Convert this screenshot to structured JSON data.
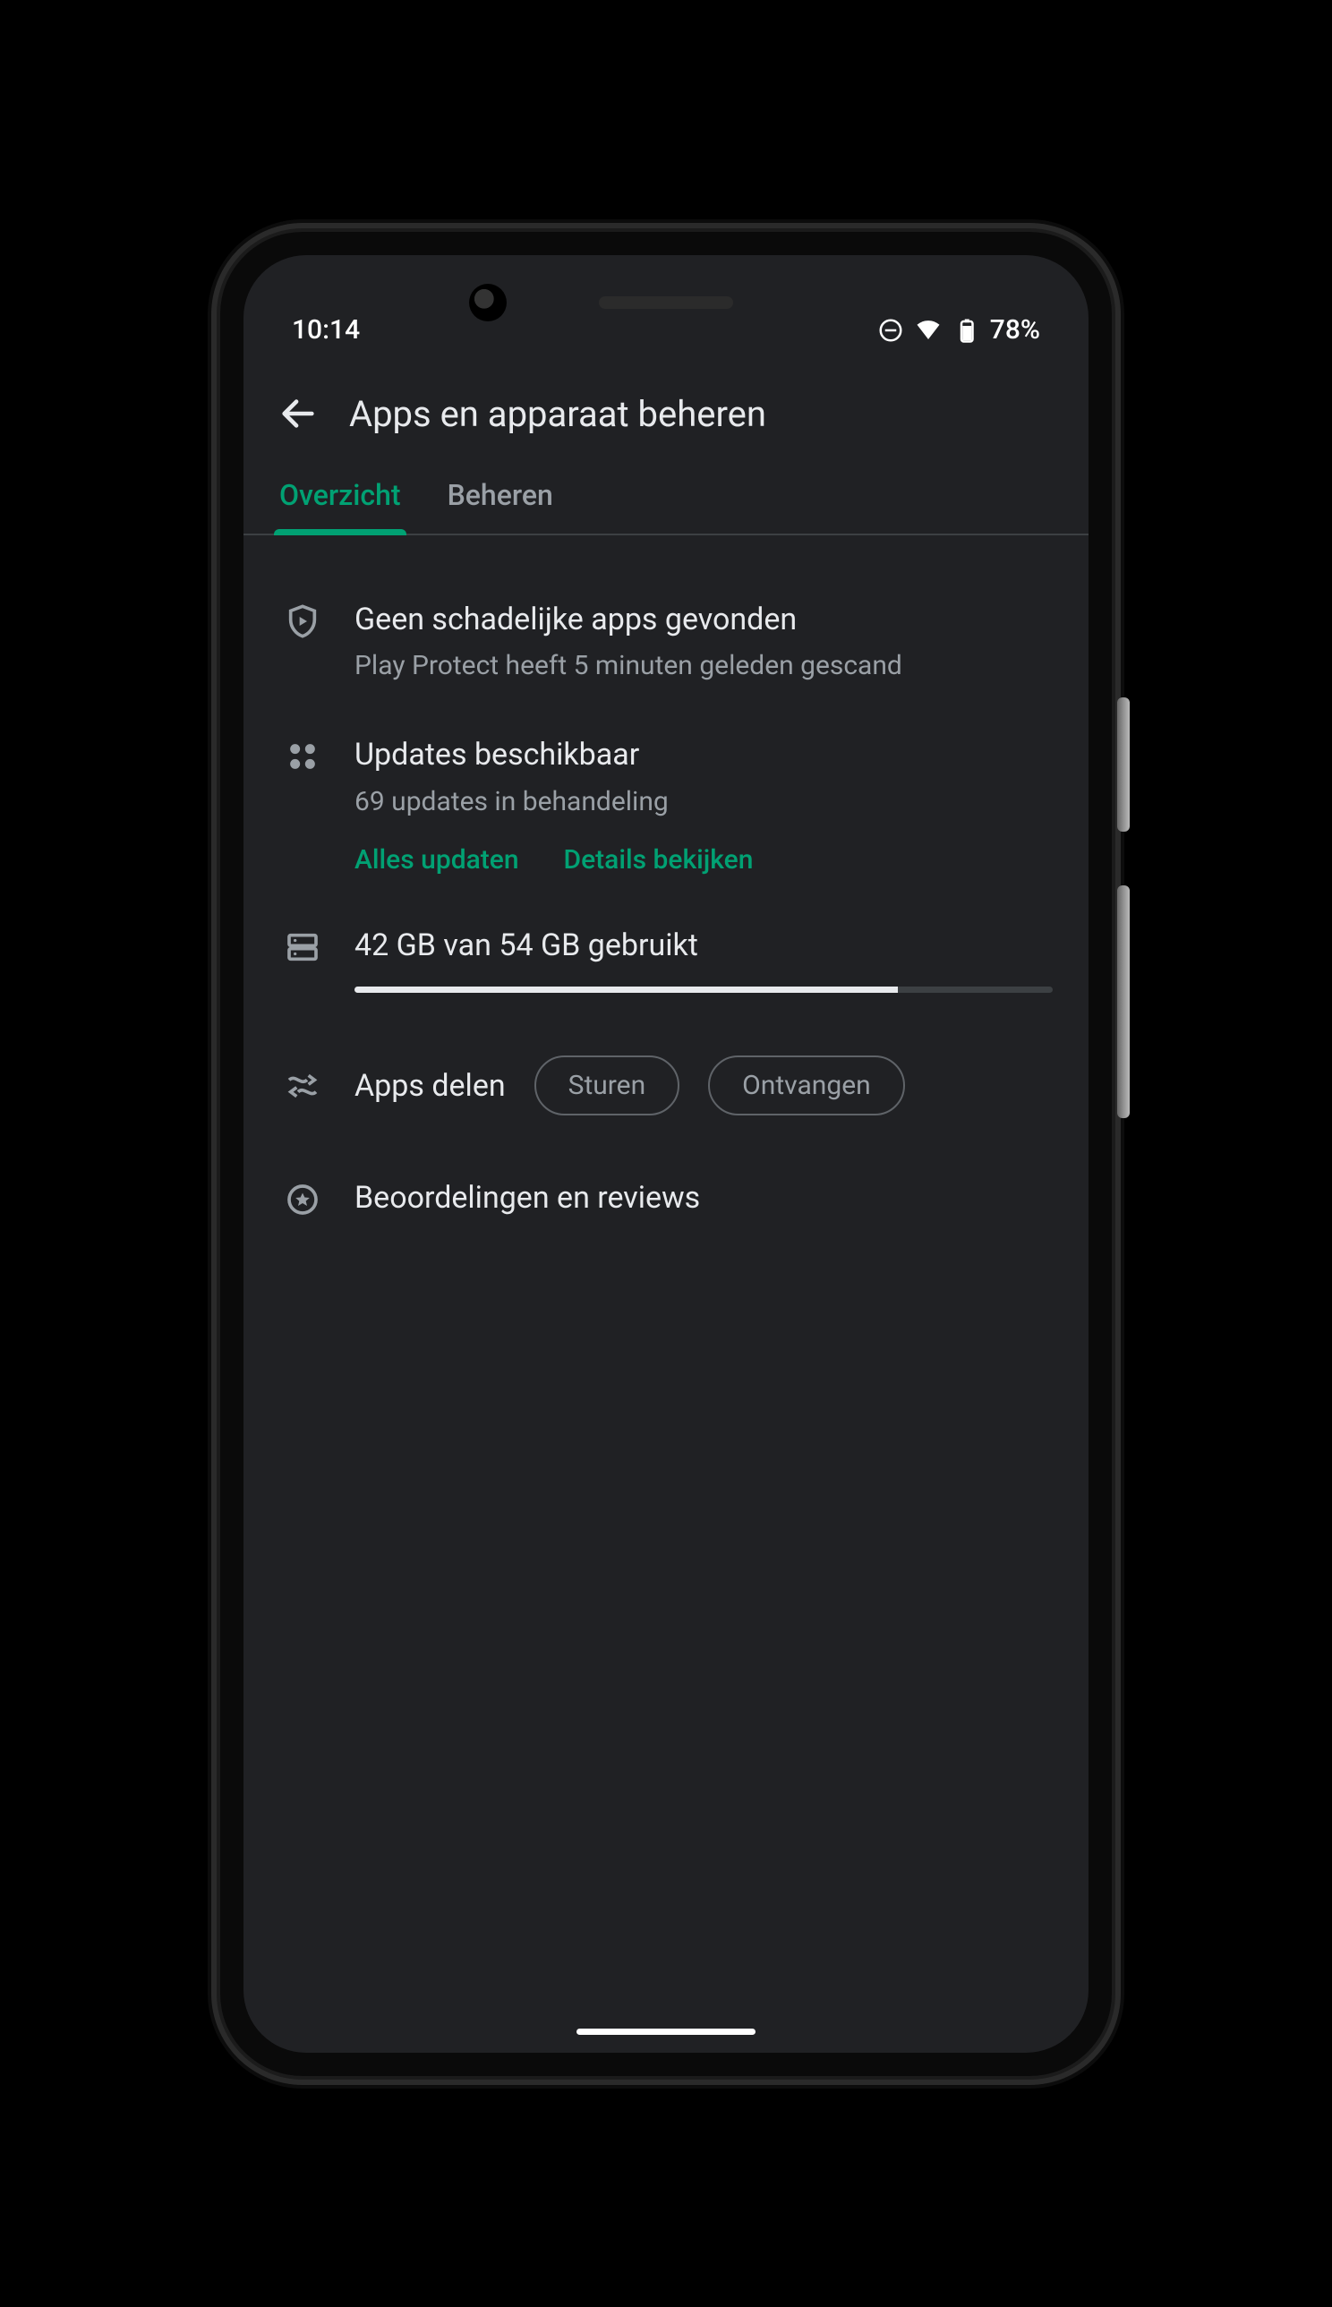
{
  "status": {
    "time": "10:14",
    "battery_text": "78%"
  },
  "header": {
    "title": "Apps en apparaat beheren"
  },
  "tabs": {
    "active": "Overzicht",
    "inactive": "Beheren"
  },
  "protect": {
    "title": "Geen schadelijke apps gevonden",
    "subtitle": "Play Protect heeft 5 minuten geleden gescand"
  },
  "updates": {
    "title": "Updates beschikbaar",
    "subtitle": "69 updates in behandeling",
    "action_update_all": "Alles updaten",
    "action_details": "Details bekijken"
  },
  "storage": {
    "label": "42 GB van 54 GB gebruikt",
    "percent": 77.8
  },
  "share": {
    "label": "Apps delen",
    "send": "Sturen",
    "receive": "Ontvangen"
  },
  "reviews": {
    "label": "Beoordelingen en reviews"
  }
}
